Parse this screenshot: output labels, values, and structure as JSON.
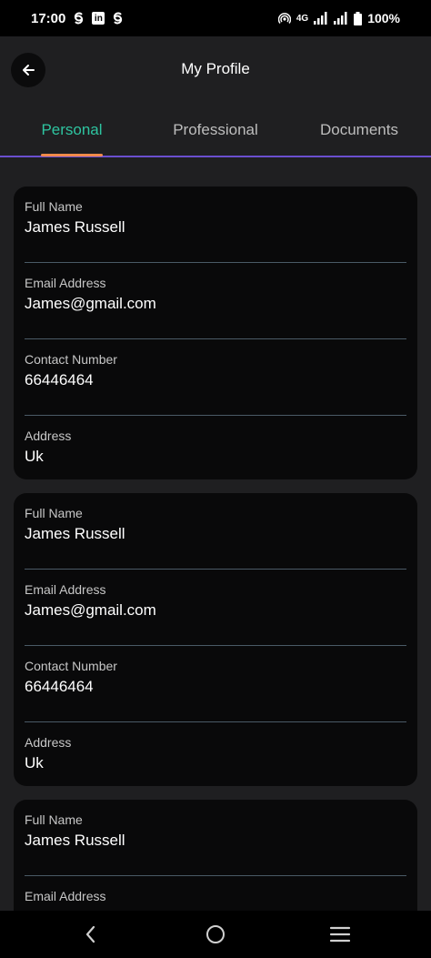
{
  "status_bar": {
    "time": "17:00",
    "network": "4G",
    "battery": "100%"
  },
  "app_bar": {
    "title": "My Profile"
  },
  "tabs": [
    {
      "label": "Personal",
      "active": true
    },
    {
      "label": "Professional",
      "active": false
    },
    {
      "label": "Documents",
      "active": false
    }
  ],
  "colors": {
    "active_tab": "#2ec4a0",
    "tab_indicator": "#f08a4b",
    "tab_underline": "#6b4fd0"
  },
  "cards": [
    {
      "fields": [
        {
          "label": "Full Name",
          "value": "James Russell"
        },
        {
          "label": "Email Address",
          "value": "James@gmail.com"
        },
        {
          "label": "Contact Number",
          "value": "66446464"
        },
        {
          "label": "Address",
          "value": "Uk"
        }
      ]
    },
    {
      "fields": [
        {
          "label": "Full Name",
          "value": "James Russell"
        },
        {
          "label": "Email Address",
          "value": "James@gmail.com"
        },
        {
          "label": "Contact Number",
          "value": "66446464"
        },
        {
          "label": "Address",
          "value": "Uk"
        }
      ]
    },
    {
      "fields": [
        {
          "label": "Full Name",
          "value": "James Russell"
        },
        {
          "label": "Email Address",
          "value": ""
        }
      ]
    }
  ]
}
